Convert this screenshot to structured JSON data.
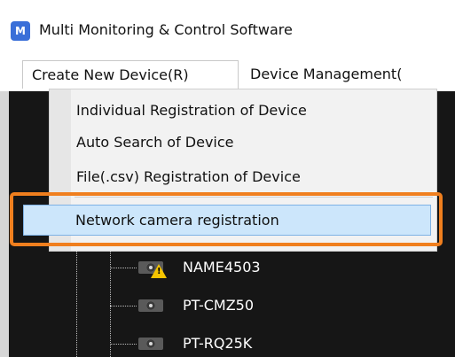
{
  "window": {
    "title": "Multi Monitoring & Control Software",
    "icon_text": "M"
  },
  "menubar": {
    "items": [
      {
        "label": "Create New Device(R)"
      },
      {
        "label": "Device Management("
      }
    ]
  },
  "dropdown": {
    "items": [
      {
        "label": "Individual Registration of Device"
      },
      {
        "label": "Auto Search of Device"
      },
      {
        "label": "File(.csv) Registration of Device"
      },
      {
        "label": "Network camera registration"
      }
    ],
    "highlight_color": "#f07f1e"
  },
  "tree": {
    "devices": [
      {
        "label": "NAME4503",
        "status": "warning"
      },
      {
        "label": "PT-CMZ50"
      },
      {
        "label": "PT-RQ25K"
      }
    ]
  },
  "icons": {
    "camera": "camera-icon",
    "warning": "warning-icon",
    "app": "app-icon"
  }
}
